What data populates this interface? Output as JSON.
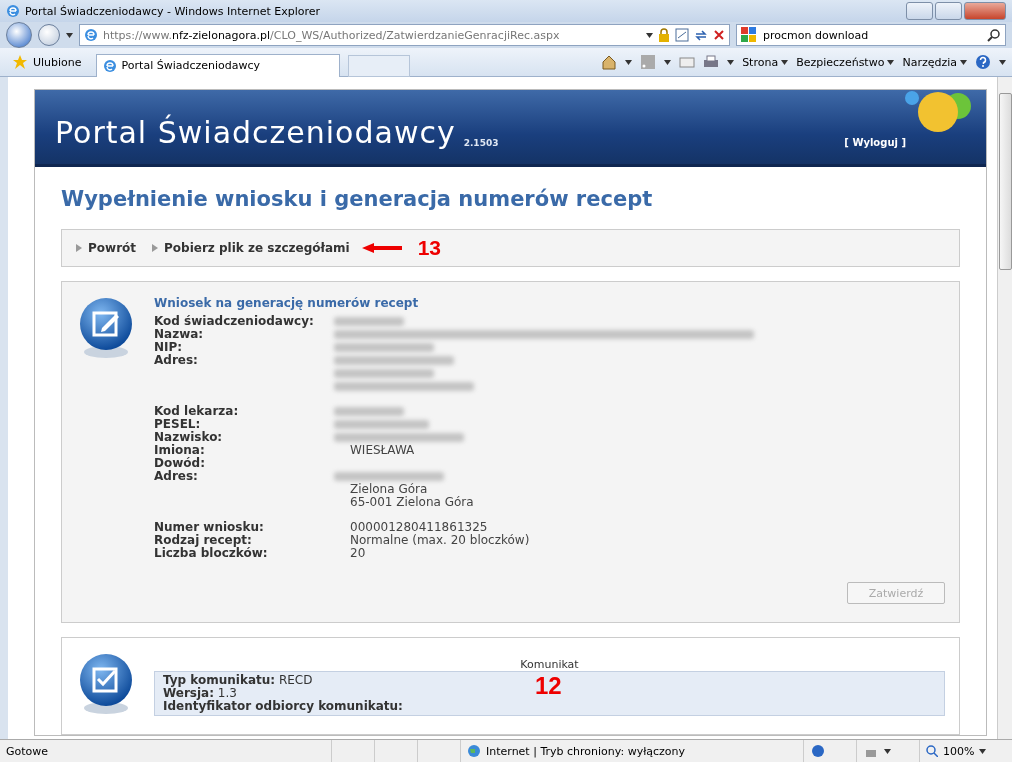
{
  "window": {
    "title": "Portal Świadczeniodawcy - Windows Internet Explorer"
  },
  "address_bar": {
    "url_prefix": "https://www.",
    "url_host": "nfz-zielonagora.pl",
    "url_path": "/CLO_WS/Authorized/ZatwierdzanieGenracjiRec.aspx",
    "search_value": "procmon download"
  },
  "favorites_bar": {
    "favorites": "Ulubione",
    "tab": "Portal Świadczeniodawcy",
    "commands": [
      "Strona",
      "Bezpieczeństwo",
      "Narzędzia"
    ]
  },
  "page": {
    "brand": "Portal Świadczeniodawcy",
    "version": "2.1503",
    "logout": "[ Wyloguj ]",
    "heading": "Wypełnienie wniosku i generacja numerów recept",
    "nav": [
      "Powrót",
      "Pobierz plik ze szczegółami"
    ],
    "nav_annotation": "13",
    "request_card": {
      "title": "Wniosek na generację numerów recept",
      "groups": [
        [
          {
            "label": "Kod świadczeniodawcy:",
            "lines": [
              {
                "redacted": true
              }
            ]
          },
          {
            "label": "Nazwa:",
            "lines": [
              {
                "redacted": true
              }
            ]
          },
          {
            "label": "NIP:",
            "lines": [
              {
                "redacted": true
              }
            ]
          },
          {
            "label": "Adres:",
            "lines": [
              {
                "redacted": true
              },
              {
                "redacted": true
              },
              {
                "redacted": true
              }
            ]
          }
        ],
        [
          {
            "label": "Kod lekarza:",
            "lines": [
              {
                "redacted": true
              }
            ]
          },
          {
            "label": "PESEL:",
            "lines": [
              {
                "redacted": true
              }
            ]
          },
          {
            "label": "Nazwisko:",
            "lines": [
              {
                "redacted": true
              }
            ]
          },
          {
            "label": "Imiona:",
            "lines": [
              {
                "redacted": false,
                "value": "WIESŁAWA"
              }
            ]
          },
          {
            "label": "Dowód:"
          },
          {
            "label": "Adres:",
            "lines": [
              {
                "redacted": true
              },
              {
                "redacted": false,
                "value": "Zielona Góra"
              },
              {
                "redacted": false,
                "value": "65-001 Zielona Góra"
              }
            ]
          }
        ],
        [
          {
            "label": "Numer wniosku:",
            "lines": [
              {
                "redacted": false,
                "value": "000001280411861325"
              }
            ]
          },
          {
            "label": "Rodzaj recept:",
            "lines": [
              {
                "redacted": false,
                "value": "Normalne (max. 20 bloczków)"
              }
            ]
          },
          {
            "label": "Liczba bloczków:",
            "lines": [
              {
                "redacted": false,
                "value": "20"
              }
            ]
          }
        ]
      ],
      "button": {
        "label": "Zatwierdź",
        "disabled": true
      }
    },
    "message_card": {
      "caption": "Komunikat",
      "annotation": "12",
      "fields": [
        {
          "label": "Typ komunikatu:",
          "value": "RECD"
        },
        {
          "label": "Wersja:",
          "value": "1.3"
        },
        {
          "label": "Identyfikator odbiorcy komunikatu:"
        }
      ]
    }
  },
  "status_bar": {
    "status": "Gotowe",
    "zone": "Internet | Tryb chroniony: wyłączony",
    "zoom": "100%"
  }
}
